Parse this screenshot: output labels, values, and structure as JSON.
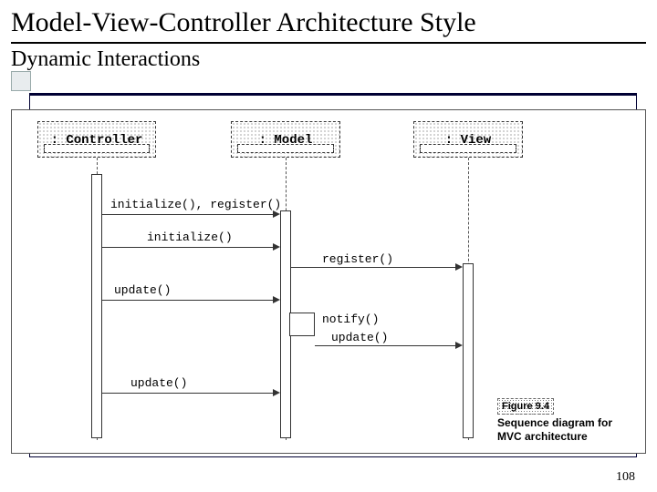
{
  "header": {
    "title": "Model-View-Controller Architecture Style",
    "subtitle": "Dynamic Interactions"
  },
  "participants": {
    "controller": ": Controller",
    "model": ": Model",
    "view": ": View"
  },
  "messages": {
    "m1": "initialize(), register()",
    "m2": "initialize()",
    "m3": "register()",
    "m4": "update()",
    "m5": "notify()",
    "m6": "update()",
    "m7": "update()"
  },
  "caption": {
    "fig": "Figure 9.4",
    "text": "Sequence diagram for MVC architecture"
  },
  "page_number": "108"
}
